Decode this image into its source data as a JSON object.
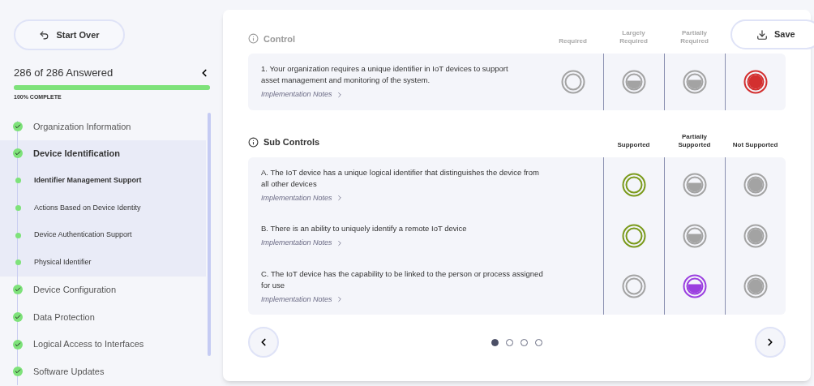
{
  "start_over": "Start Over",
  "progress": {
    "label": "286 of 286 Answered",
    "level": 1,
    "caption": "100% COMPLETE"
  },
  "sections": [
    {
      "label": "Organization Information",
      "completed": true,
      "expanded": false
    },
    {
      "label": "Device Identification",
      "completed": true,
      "expanded": true,
      "children": [
        {
          "label": "Identifier Management Support",
          "selected": true
        },
        {
          "label": "Actions Based on Device Identity",
          "selected": false
        },
        {
          "label": "Device Authentication Support",
          "selected": false
        },
        {
          "label": "Physical Identifier",
          "selected": false
        }
      ]
    },
    {
      "label": "Device Configuration",
      "completed": true,
      "expanded": false
    },
    {
      "label": "Data Protection",
      "completed": true,
      "expanded": false
    },
    {
      "label": "Logical Access to Interfaces",
      "completed": true,
      "expanded": false
    },
    {
      "label": "Software Updates",
      "completed": true,
      "expanded": false
    }
  ],
  "save": "Save",
  "control": {
    "title": "Control",
    "columns": [
      {
        "label": "Required",
        "kind": "empty"
      },
      {
        "label": "Largely\nRequired",
        "kind": "low"
      },
      {
        "label": "Partially\nRequired",
        "kind": "half"
      },
      {
        "kind": "full",
        "color": "#d32f2f"
      }
    ],
    "rows": [
      {
        "text": "1. Your organization requires a unique identifier in IoT devices to support asset management and monitoring of the system.",
        "notes": "Implementation Notes",
        "options": [
          {
            "selected": false
          },
          {
            "selected": false
          },
          {
            "selected": false
          },
          {
            "selected": true
          }
        ]
      }
    ]
  },
  "sub_controls": {
    "title": "Sub Controls",
    "columns": [
      {
        "label": "Supported",
        "kind": "empty",
        "color": "#7a9a1a"
      },
      {
        "label": "Partially\nSupported",
        "kind": "half",
        "color": "#9b3fe0"
      },
      {
        "label": "Not Supported",
        "kind": "full"
      }
    ],
    "rows": [
      {
        "text": "A. The IoT device has a unique logical identifier that distinguishes the device from all other devices",
        "notes": "Implementation Notes",
        "options": [
          {
            "selected": true
          },
          {
            "selected": false
          },
          {
            "selected": false
          }
        ]
      },
      {
        "text": "B. There is an ability to uniquely identify a remote IoT device",
        "notes": "Implementation Notes",
        "options": [
          {
            "selected": true
          },
          {
            "selected": false
          },
          {
            "selected": false
          }
        ]
      },
      {
        "text": "C. The IoT device has the capability to be linked to the person or process assigned for use",
        "notes": "Implementation Notes",
        "options": [
          {
            "selected": false
          },
          {
            "selected": true
          },
          {
            "selected": false
          }
        ]
      }
    ]
  },
  "pages": [
    {
      "selected": true
    },
    {
      "selected": false
    },
    {
      "selected": false
    },
    {
      "selected": false
    }
  ]
}
